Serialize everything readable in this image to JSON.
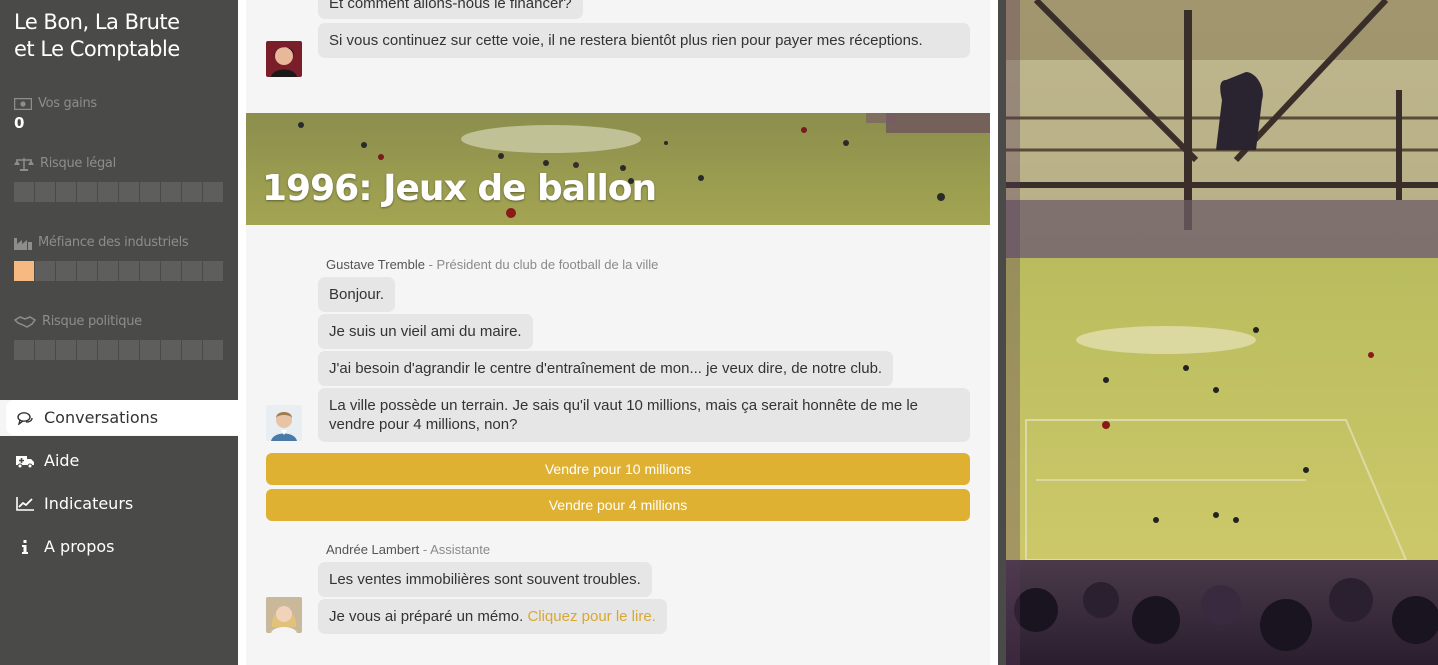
{
  "app": {
    "title_line1": "Le Bon, La Brute",
    "title_line2": "et Le Comptable"
  },
  "stats": {
    "gains": {
      "label": "Vos gains",
      "value": "0"
    },
    "legal": {
      "label": "Risque légal",
      "level": 0,
      "max": 10
    },
    "industry": {
      "label": "Méfiance des industriels",
      "level": 1,
      "max": 10
    },
    "political": {
      "label": "Risque politique",
      "level": 0,
      "max": 10
    }
  },
  "nav": [
    {
      "label": "Conversations",
      "icon": "chat-icon",
      "active": true
    },
    {
      "label": "Aide",
      "icon": "ambulance-icon",
      "active": false
    },
    {
      "label": "Indicateurs",
      "icon": "chart-line-icon",
      "active": false
    },
    {
      "label": "A propos",
      "icon": "info-icon",
      "active": false
    }
  ],
  "chat": {
    "prev_message_partial": "Et comment allons-nous le financer?",
    "prev_message": "Si vous continuez sur cette voie, il ne restera bientôt plus rien pour payer mes réceptions.",
    "chapter_title": "1996: Jeux de ballon",
    "speaker1": {
      "name": "Gustave Tremble",
      "role": " - Président du club de football de la ville"
    },
    "speaker1_messages": [
      "Bonjour.",
      "Je suis un vieil ami du maire.",
      "J'ai besoin d'agrandir le centre d'entraînement de mon... je veux dire, de notre club.",
      "La ville possède un terrain. Je sais qu'il vaut 10 millions, mais ça serait honnête de me le vendre pour 4 millions, non?"
    ],
    "choices": [
      "Vendre pour 10 millions",
      "Vendre pour 4 millions"
    ],
    "speaker2": {
      "name": "Andrée Lambert",
      "role": " - Assistante"
    },
    "speaker2_message1": "Les ventes immobilières sont souvent troubles.",
    "speaker2_message2_text": "Je vous ai préparé un mémo. ",
    "speaker2_message2_link": "Cliquez pour le lire."
  },
  "colors": {
    "sidebar": "#4a4a48",
    "accent": "#dfb132",
    "meter_on": "#f5b981",
    "meter_off": "#5e5e5c",
    "bubble": "#e6e6e6"
  }
}
